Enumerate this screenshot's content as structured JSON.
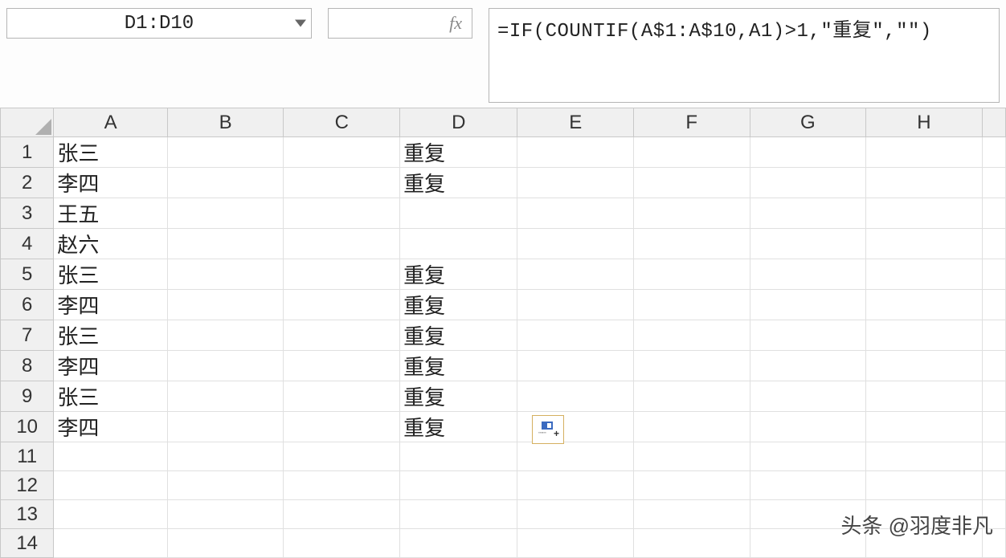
{
  "formula_bar": {
    "name_box": "D1:D10",
    "fx_label": "fx",
    "formula": "=IF(COUNTIF(A$1:A$10,A1)>1,\"重复\",\"\")"
  },
  "columns": [
    "A",
    "B",
    "C",
    "D",
    "E",
    "F",
    "G",
    "H"
  ],
  "rows": [
    {
      "num": "1",
      "A": "张三",
      "B": "",
      "C": "",
      "D": "重复",
      "E": "",
      "F": "",
      "G": "",
      "H": ""
    },
    {
      "num": "2",
      "A": "李四",
      "B": "",
      "C": "",
      "D": "重复",
      "E": "",
      "F": "",
      "G": "",
      "H": ""
    },
    {
      "num": "3",
      "A": "王五",
      "B": "",
      "C": "",
      "D": "",
      "E": "",
      "F": "",
      "G": "",
      "H": ""
    },
    {
      "num": "4",
      "A": "赵六",
      "B": "",
      "C": "",
      "D": "",
      "E": "",
      "F": "",
      "G": "",
      "H": ""
    },
    {
      "num": "5",
      "A": "张三",
      "B": "",
      "C": "",
      "D": "重复",
      "E": "",
      "F": "",
      "G": "",
      "H": ""
    },
    {
      "num": "6",
      "A": "李四",
      "B": "",
      "C": "",
      "D": "重复",
      "E": "",
      "F": "",
      "G": "",
      "H": ""
    },
    {
      "num": "7",
      "A": "张三",
      "B": "",
      "C": "",
      "D": "重复",
      "E": "",
      "F": "",
      "G": "",
      "H": ""
    },
    {
      "num": "8",
      "A": "李四",
      "B": "",
      "C": "",
      "D": "重复",
      "E": "",
      "F": "",
      "G": "",
      "H": ""
    },
    {
      "num": "9",
      "A": "张三",
      "B": "",
      "C": "",
      "D": "重复",
      "E": "",
      "F": "",
      "G": "",
      "H": ""
    },
    {
      "num": "10",
      "A": "李四",
      "B": "",
      "C": "",
      "D": "重复",
      "E": "",
      "F": "",
      "G": "",
      "H": ""
    },
    {
      "num": "11",
      "A": "",
      "B": "",
      "C": "",
      "D": "",
      "E": "",
      "F": "",
      "G": "",
      "H": ""
    },
    {
      "num": "12",
      "A": "",
      "B": "",
      "C": "",
      "D": "",
      "E": "",
      "F": "",
      "G": "",
      "H": ""
    },
    {
      "num": "13",
      "A": "",
      "B": "",
      "C": "",
      "D": "",
      "E": "",
      "F": "",
      "G": "",
      "H": ""
    },
    {
      "num": "14",
      "A": "",
      "B": "",
      "C": "",
      "D": "",
      "E": "",
      "F": "",
      "G": "",
      "H": ""
    }
  ],
  "watermark": "头条 @羽度非凡"
}
